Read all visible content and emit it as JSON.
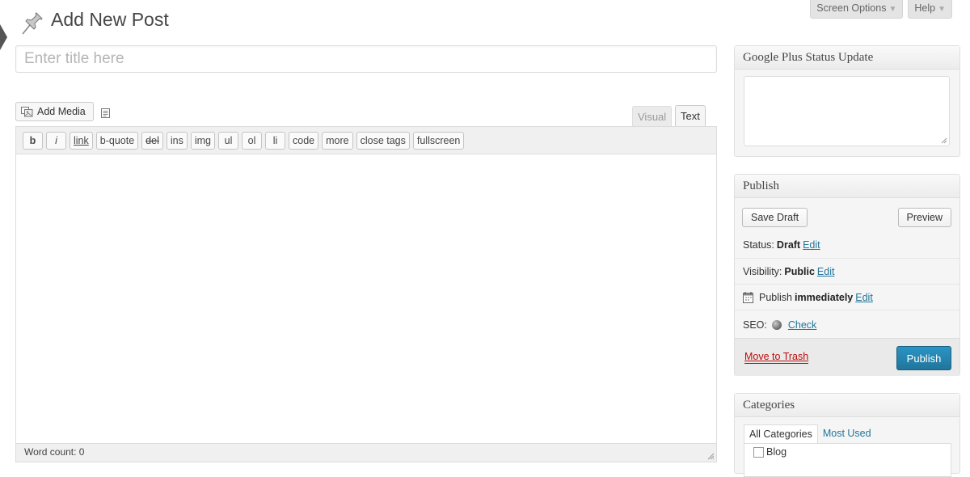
{
  "header": {
    "page_title": "Add New Post",
    "screen_options": "Screen Options",
    "help": "Help",
    "caret": "▼"
  },
  "title_input": {
    "placeholder": "Enter title here",
    "value": ""
  },
  "editor": {
    "add_media": "Add Media",
    "tabs": {
      "visual": "Visual",
      "text": "Text"
    },
    "quicktags": [
      "b",
      "i",
      "link",
      "b-quote",
      "del",
      "ins",
      "img",
      "ul",
      "ol",
      "li",
      "code",
      "more",
      "close tags",
      "fullscreen"
    ],
    "word_count": "Word count: 0"
  },
  "gplus_box": {
    "title": "Google Plus Status Update"
  },
  "publish_box": {
    "title": "Publish",
    "save_draft": "Save Draft",
    "preview": "Preview",
    "status_label": "Status:",
    "status_value": "Draft",
    "visibility_label": "Visibility:",
    "visibility_value": "Public",
    "publish_label": "Publish",
    "publish_value": "immediately",
    "seo_label": "SEO:",
    "seo_check": "Check",
    "edit": "Edit",
    "move_to_trash": "Move to Trash",
    "publish_button": "Publish"
  },
  "categories_box": {
    "title": "Categories",
    "tab_all": "All Categories",
    "tab_most_used": "Most Used",
    "items": [
      "Blog"
    ]
  },
  "colors": {
    "link": "#21759b",
    "trash": "#bc0b0b",
    "primary": "#21759b"
  }
}
